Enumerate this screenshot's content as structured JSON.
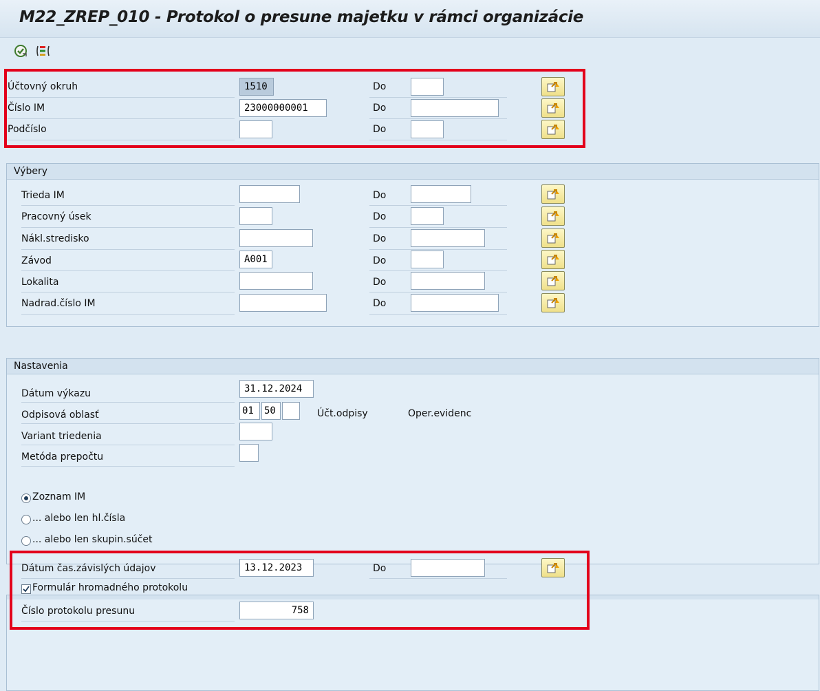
{
  "title": "M22_ZREP_010 - Protokol o presune majetku v rámci organizácie",
  "toolbar": {
    "execute_icon": "execute-icon",
    "selection_options_icon": "selection-options-icon"
  },
  "do_label": "Do",
  "top_block": {
    "rows": [
      {
        "label": "Účtovný okruh",
        "value": "1510",
        "to": ""
      },
      {
        "label": "Číslo IM",
        "value": "23000000001",
        "to": ""
      },
      {
        "label": "Podčíslo",
        "value": "",
        "to": ""
      }
    ]
  },
  "vybery": {
    "title": "Výbery",
    "rows": [
      {
        "label": "Trieda IM",
        "value": "",
        "to": ""
      },
      {
        "label": "Pracovný úsek",
        "value": "",
        "to": ""
      },
      {
        "label": "Nákl.stredisko",
        "value": "",
        "to": ""
      },
      {
        "label": "Závod",
        "value": "A001",
        "to": ""
      },
      {
        "label": "Lokalita",
        "value": "",
        "to": ""
      },
      {
        "label": "Nadrad.číslo IM",
        "value": "",
        "to": ""
      }
    ]
  },
  "nastavenia": {
    "title": "Nastavenia",
    "report_date_label": "Dátum výkazu",
    "report_date": "31.12.2024",
    "depr_area_label": "Odpisová oblasť",
    "depr_area_1": "01",
    "depr_area_2": "50",
    "depr_area_3": "",
    "depr_area_text_1": "Účt.odpisy",
    "depr_area_text_2": "Oper.evidenc",
    "sort_variant_label": "Variant triedenia",
    "sort_variant": "",
    "conversion_label": "Metóda prepočtu",
    "conversion": "",
    "radio_1": "Zoznam IM",
    "radio_2": "... alebo len hl.čísla",
    "radio_3": "... alebo len skupin.súčet",
    "selected_radio": 1
  },
  "bottom_block": {
    "time_dep_label": "Dátum  čas.závislých údajov",
    "time_dep_date": "13.12.2023",
    "time_dep_to": "",
    "form_checkbox_label": "Formulár hromadného protokolu",
    "form_checked": true,
    "protocol_no_label": "Číslo protokolu presunu",
    "protocol_no": "758"
  },
  "colors": {
    "highlight": "#e3001b",
    "background": "#dfebf5",
    "button": "#f5ea9e"
  }
}
